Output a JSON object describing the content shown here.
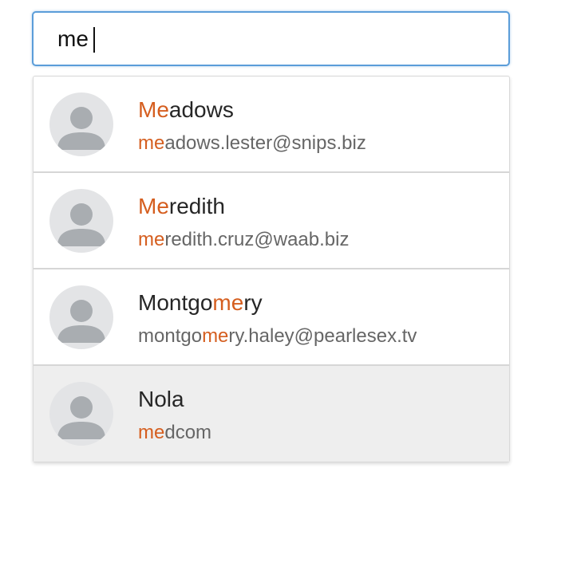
{
  "search": {
    "value": "me",
    "placeholder": ""
  },
  "colors": {
    "highlight": "#d55e1f",
    "focus_border": "#5b9dd9",
    "hover_row": "#eeeeee"
  },
  "results": [
    {
      "name_before": "",
      "name_match": "Me",
      "name_after": "adows",
      "email_before": "",
      "email_match": "me",
      "email_after": "adows.lester@snips.biz",
      "icon": "user-avatar-icon",
      "highlighted": false
    },
    {
      "name_before": "",
      "name_match": "Me",
      "name_after": "redith",
      "email_before": "",
      "email_match": "me",
      "email_after": "redith.cruz@waab.biz",
      "icon": "user-avatar-icon",
      "highlighted": false
    },
    {
      "name_before": "Montgo",
      "name_match": "me",
      "name_after": "ry",
      "email_before": "montgo",
      "email_match": "me",
      "email_after": "ry.haley@pearlesex.tv",
      "icon": "user-avatar-icon",
      "highlighted": false
    },
    {
      "name_before": "Nola",
      "name_match": "",
      "name_after": "",
      "email_before": "",
      "email_match": "me",
      "email_after": "dcom",
      "icon": "user-avatar-icon",
      "highlighted": true
    }
  ]
}
